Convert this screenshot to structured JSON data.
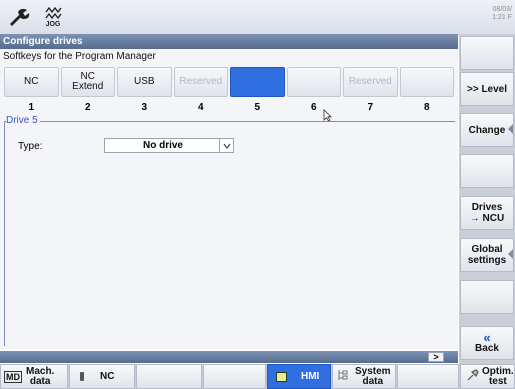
{
  "topbar": {
    "mode_label": "JOG",
    "date": "08/03/",
    "time": "1:21 F"
  },
  "window": {
    "title": "Configure drives",
    "subtitle": "Softkeys for the Program Manager"
  },
  "softkeys": [
    {
      "line1": "NC",
      "line2": "",
      "state": "normal"
    },
    {
      "line1": "NC",
      "line2": "Extend",
      "state": "normal"
    },
    {
      "line1": "USB",
      "line2": "",
      "state": "normal"
    },
    {
      "line1": "Reserved",
      "line2": "",
      "state": "disabled"
    },
    {
      "line1": "",
      "line2": "",
      "state": "selected"
    },
    {
      "line1": "",
      "line2": "",
      "state": "normal"
    },
    {
      "line1": "Reserved",
      "line2": "",
      "state": "disabled"
    },
    {
      "line1": "",
      "line2": "",
      "state": "normal"
    }
  ],
  "softkey_numbers": [
    "1",
    "2",
    "3",
    "4",
    "5",
    "6",
    "7",
    "8"
  ],
  "drive": {
    "group_title": "Drive 5",
    "type_label": "Type:",
    "type_value": "No drive"
  },
  "scroll": {
    "arrow": ">"
  },
  "vertical_softkeys": {
    "level": ">> Level",
    "change": "Change",
    "drives_ncu_l1": "Drives",
    "drives_ncu_l2": "→ NCU",
    "global_l1": "Global",
    "global_l2": "settings",
    "back": "Back",
    "back_arrow": "«"
  },
  "bottom_softkeys": {
    "mach_l1": "Mach.",
    "mach_l2": "data",
    "md_icon_text": "MD",
    "nc": "NC",
    "hmi": "HMI",
    "system_l1": "System",
    "system_l2": "data",
    "optim_l1": "Optim.",
    "optim_l2": "test"
  },
  "colors": {
    "title_bar": "#566c8f",
    "selected_softkey": "#2f6fe0",
    "group_frame": "#7d8cc6"
  }
}
